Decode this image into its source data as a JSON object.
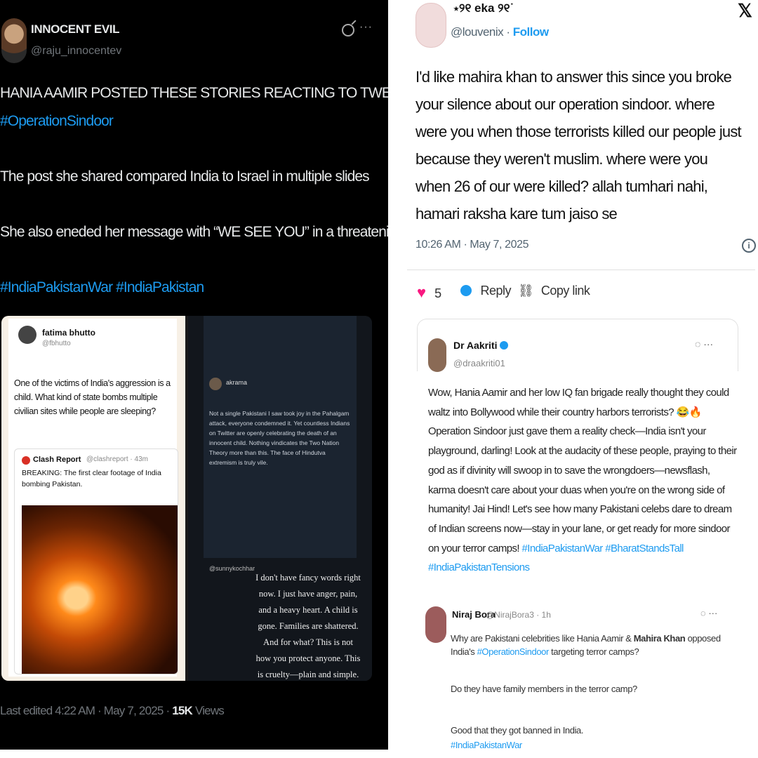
{
  "left_post": {
    "author_name": "INNOCENT EVIL",
    "author_handle": "@raju_innocentev",
    "line1": "HANIA AAMIR POSTED THESE STORIES REACTING TO TWEETS ABOUT",
    "hashtag1": "#OperationSindoor",
    "line2": "The post she shared compared India to Israel in multiple slides",
    "line3": "She also eneded her message with “WE SEE YOU” in a threatening tone",
    "hashtags2": "#IndiaPakistanWar #IndiaPakistan",
    "footer_prefix": "Last edited 4:22 AM · May 7, 2025 · ",
    "views_count": "15K",
    "views_label": " Views"
  },
  "story1": {
    "name": "fatima bhutto",
    "handle": "@fbhutto",
    "text": "One of the victims of India's aggression is a child. What kind of state bombs multiple civilian sites while people are sleeping?",
    "quote_name": "Clash Report",
    "quote_handle": "@clashreport · 43m",
    "quote_text": "BREAKING: The first clear footage of India bombing Pakistan."
  },
  "story2": {
    "name": "akrama",
    "text": "Not a single Pakistani I saw took joy in the Pahalgam attack, everyone condemned it. Yet countless Indians on Twitter are openly celebrating the death of an innocent child. Nothing vindicates the Two Nation Theory more than this. The face of Hindutva extremism is truly vile.",
    "credit": "@sunnykochhar",
    "overlay_text": "I don't have fancy words right now. I just have anger, pain, and a heavy heart. A child is gone. Families are shattered. And for what? This is not how you protect anyone. This is cruelty—plain and simple. You don't get to bomb"
  },
  "right_post": {
    "author_name": "⋆୨୧ eka ୨୧˙",
    "author_handle": "@louvenix",
    "follow_label": "Follow",
    "text": "I'd like mahira khan to answer this since you broke your silence about our operation sindoor. where were you when those terrorists killed our people just because they weren't muslim. where were you when 26 of our were killed? allah tumhari nahi, hamari raksha kare tum jaiso se",
    "timestamp": "10:26 AM · May 7, 2025",
    "like_count": "5",
    "reply_label": "Reply",
    "copy_link_label": "Copy link"
  },
  "aakriti_post": {
    "author_name": "Dr Aakriti",
    "author_handle": "@draakriti01",
    "text": "Wow, Hania Aamir and her low IQ fan brigade really thought they could waltz into Bollywood while their country harbors terrorists? 😂🔥 Operation Sindoor just gave them a reality check—India isn't your playground, darling! Look at the audacity of these people, praying to their god as if divinity will swoop in to save the wrongdoers—newsflash, karma doesn't care about your duas when you're on the wrong side of humanity! Jai Hind! Let's see how many Pakistani celebs dare to dream of Indian screens now—stay in your lane, or get ready for more sindoor on your terror camps!",
    "hashtags": "#IndiaPakistanWar #BharatStandsTall #IndiaPakistanTensions"
  },
  "niraj_post": {
    "author_name": "Niraj Bora",
    "author_handle": "@NirajBora3 · 1h",
    "text_a": "Why are Pakistani celebrities like Hania Aamir & ",
    "text_bold": "Mahira Khan",
    "text_b": " opposed India's ",
    "hashtag": "#OperationSindoor",
    "text_c": " targeting terror camps?",
    "question": "Do they have family members in the terror camp?",
    "closing": "Good that they got banned in India.",
    "closing_hashtag": "#IndiaPakistanWar"
  },
  "icons": {
    "grok": "grok-icon",
    "more": "more-icon",
    "x_logo": "𝕏",
    "info": "i",
    "heart": "♥",
    "link": "🔗"
  },
  "colors": {
    "accent": "#1d9bf0",
    "like": "#f91880",
    "dark_bg": "#000000"
  }
}
